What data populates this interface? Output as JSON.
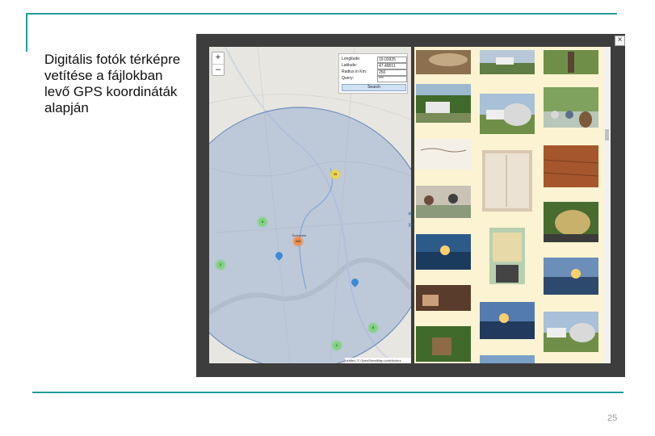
{
  "slide": {
    "title": "Digitális fotók térképre vetítése a fájlokban levő GPS koordináták alapján",
    "page_number": "25"
  },
  "map_app": {
    "close_label": "×",
    "zoom": {
      "in_label": "+",
      "out_label": "–"
    },
    "search_form": {
      "longitude_label": "Longitude:",
      "longitude_value": "19.03935",
      "latitude_label": "Latitude:",
      "latitude_value": "47.49511",
      "radius_label": "Radius in Km:",
      "radius_value": "250",
      "query_label": "Query:",
      "query_value": "***",
      "search_button": "Search"
    },
    "city_label": "Budapest",
    "markers": [
      {
        "label": "45",
        "color": "yellow"
      },
      {
        "label": "5",
        "color": "green"
      },
      {
        "label": "445",
        "color": "orange"
      },
      {
        "label": "2",
        "color": "green"
      },
      {
        "label": "8",
        "color": "green"
      },
      {
        "label": "2",
        "color": "green"
      }
    ],
    "attribution": "Leaflet | © OpenStreetMap contributors",
    "toggle_arrows": {
      "left": "«",
      "right": "»"
    }
  },
  "colors": {
    "accent_line": "#1f9e99",
    "frame": "#3d3d3d",
    "gallery_bg": "#fbf3d1",
    "radius_circle": "#8aa7d0"
  },
  "icons": [
    "close-icon",
    "zoom-in-icon",
    "zoom-out-icon",
    "map-pin-icon",
    "collapse-arrow-icon"
  ]
}
